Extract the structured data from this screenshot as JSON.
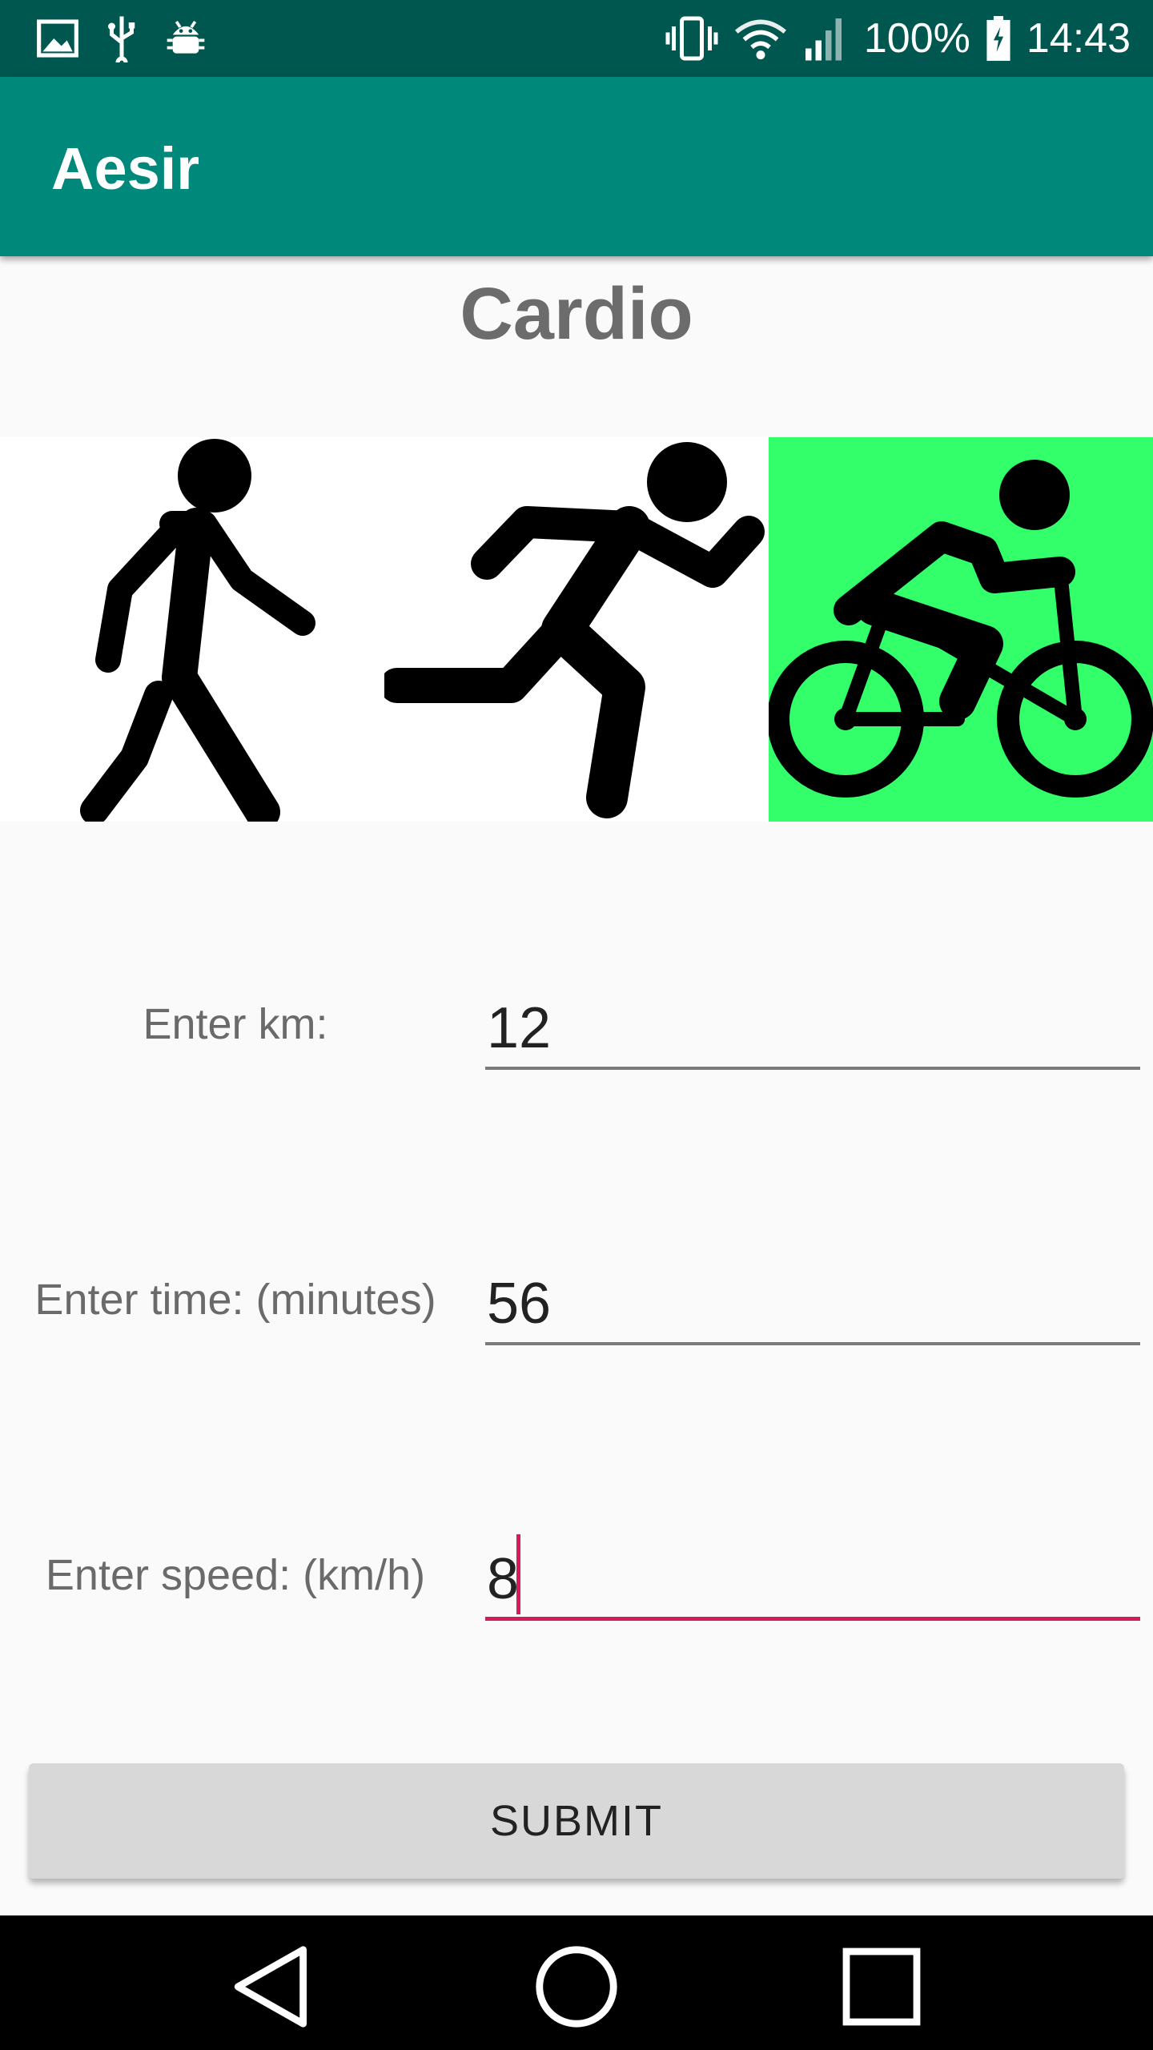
{
  "status_bar": {
    "battery_percent": "100%",
    "time": "14:43",
    "left_icons": [
      "image-icon",
      "usb-icon",
      "android-debug-icon"
    ],
    "right_icons": [
      "vibrate-icon",
      "wifi-icon",
      "signal-icon",
      "battery-charging-icon"
    ]
  },
  "app_bar": {
    "title": "Aesir"
  },
  "page": {
    "title": "Cardio"
  },
  "activities": {
    "items": [
      {
        "icon": "walking-icon",
        "selected": false
      },
      {
        "icon": "running-icon",
        "selected": false
      },
      {
        "icon": "cycling-icon",
        "selected": true
      }
    ],
    "selected_color": "#33ff6b"
  },
  "form": {
    "km_label": "Enter km:",
    "km_value": "12",
    "time_label": "Enter time: (minutes)",
    "time_value": "56",
    "speed_label": "Enter speed: (km/h)",
    "speed_value": "8",
    "submit_label": "SUBMIT"
  },
  "colors": {
    "status_bar": "#00574f",
    "app_bar": "#00887a",
    "accent": "#d21c5c"
  },
  "nav_bar": {
    "icons": [
      "back-icon",
      "home-icon",
      "recents-icon"
    ]
  }
}
